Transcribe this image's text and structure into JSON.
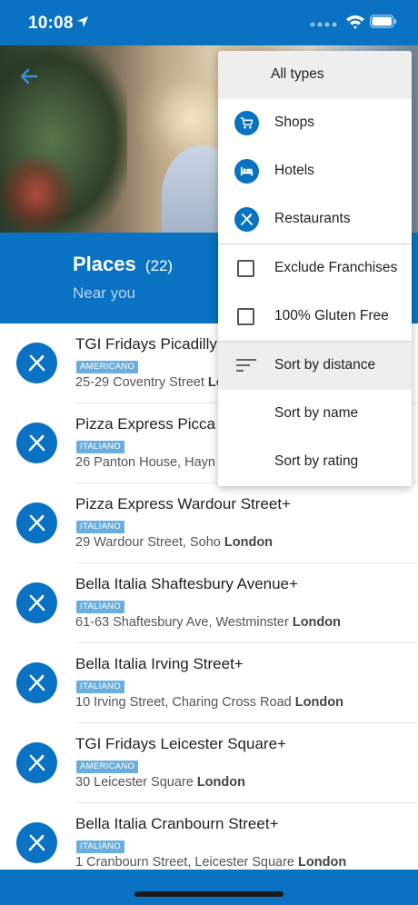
{
  "status_bar": {
    "time": "10:08"
  },
  "header": {
    "title": "Places",
    "count": "(22)",
    "subtitle": "Near you"
  },
  "menu": {
    "types": [
      {
        "label": "All types",
        "icon": "none",
        "selected": true
      },
      {
        "label": "Shops",
        "icon": "cart-icon"
      },
      {
        "label": "Hotels",
        "icon": "bed-icon"
      },
      {
        "label": "Restaurants",
        "icon": "cutlery-icon"
      }
    ],
    "filters": [
      {
        "label": "Exclude Franchises",
        "checked": false
      },
      {
        "label": "100% Gluten Free",
        "checked": false
      }
    ],
    "sorts": [
      {
        "label": "Sort by distance",
        "selected": true
      },
      {
        "label": "Sort by name"
      },
      {
        "label": "Sort by rating"
      }
    ]
  },
  "places": [
    {
      "name": "TGI Fridays Picadilly",
      "tag": "AMERICANO",
      "street": "25-29 Coventry Street",
      "city": "London"
    },
    {
      "name": "Pizza Express Picca",
      "tag": "ITALIANO",
      "street": "26 Panton House, Hayn",
      "city": ""
    },
    {
      "name": "Pizza Express Wardour Street+",
      "tag": "ITALIANO",
      "street": "29 Wardour Street, Soho",
      "city": "London"
    },
    {
      "name": "Bella Italia Shaftesbury Avenue+",
      "tag": "ITALIANO",
      "street": "61-63 Shaftesbury Ave, Westminster",
      "city": "London"
    },
    {
      "name": "Bella Italia Irving Street+",
      "tag": "ITALIANO",
      "street": "10 Irving Street, Charing Cross Road",
      "city": "London"
    },
    {
      "name": "TGI Fridays Leicester Square+",
      "tag": "AMERICANO",
      "street": "30 Leicester Square",
      "city": "London"
    },
    {
      "name": "Bella Italia Cranbourn Street+",
      "tag": "ITALIANO",
      "street": "1 Cranbourn Street, Leicester Square",
      "city": "London"
    }
  ],
  "colors": {
    "primary": "#0a72c2",
    "tag": "#6aaede",
    "menu_highlight": "#eeeeee"
  }
}
